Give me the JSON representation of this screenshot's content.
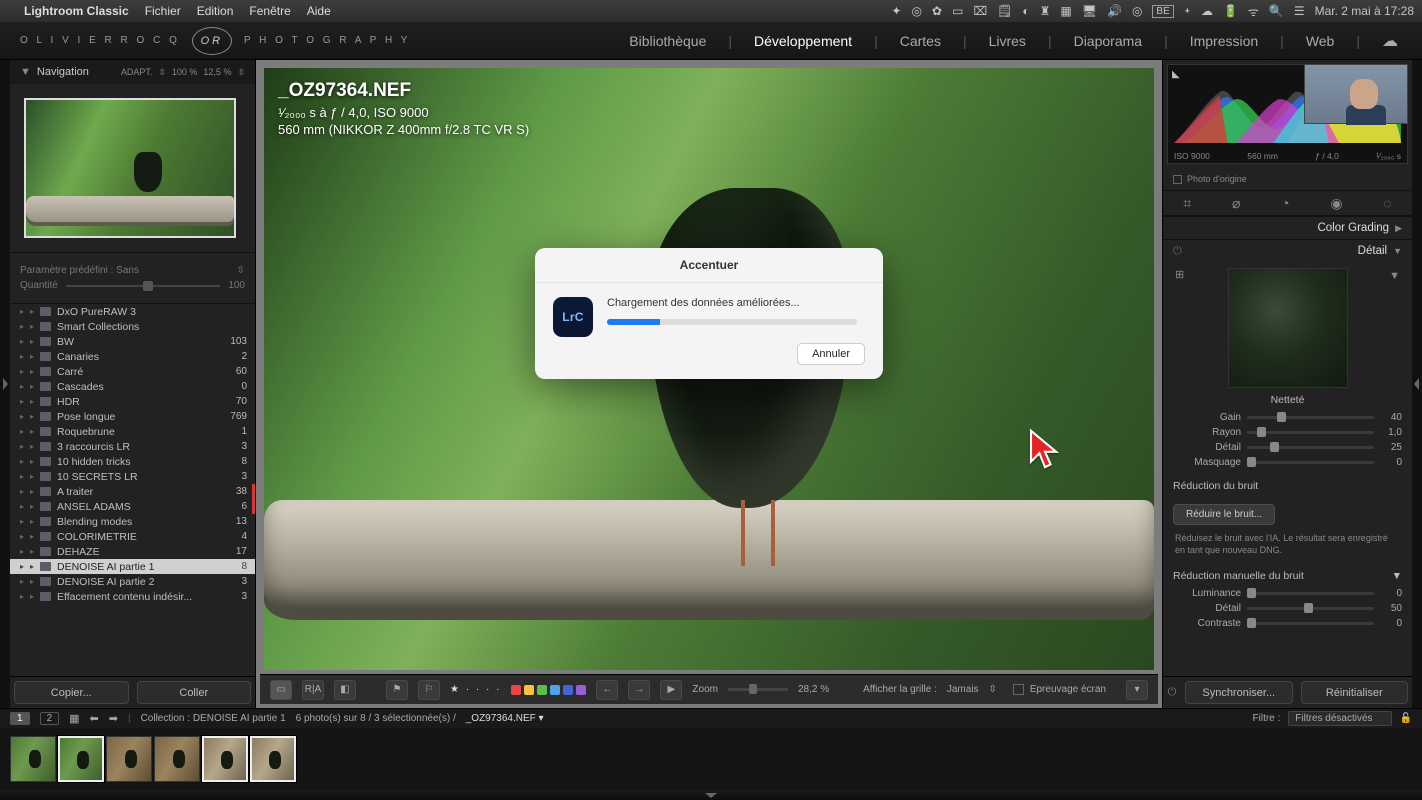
{
  "mac_menu": {
    "app": "Lightroom Classic",
    "items": [
      "Fichier",
      "Edition",
      "Fenêtre",
      "Aide"
    ],
    "datetime": "Mar. 2 mai à 17:28",
    "lang": "BE"
  },
  "brand": {
    "left": "O L I V I E R   R O C Q",
    "right": "P H O T O G R A P H Y",
    "monogram": "OR"
  },
  "modules": {
    "items": [
      "Bibliothèque",
      "Développement",
      "Cartes",
      "Livres",
      "Diaporama",
      "Impression",
      "Web"
    ],
    "active": "Développement"
  },
  "navigation": {
    "title": "Navigation",
    "fit_label": "ADAPT.",
    "zoom_a": "100 %",
    "zoom_b": "12,5 %"
  },
  "preset": {
    "label": "Paramètre prédéfini : Sans",
    "qty_label": "Quantité",
    "qty_value": "100"
  },
  "collections": [
    {
      "name": "DxO PureRAW 3",
      "count": ""
    },
    {
      "name": "Smart Collections",
      "count": ""
    },
    {
      "name": "BW",
      "count": "103"
    },
    {
      "name": "Canaries",
      "count": "2"
    },
    {
      "name": "Carré",
      "count": "60"
    },
    {
      "name": "Cascades",
      "count": "0"
    },
    {
      "name": "HDR",
      "count": "70"
    },
    {
      "name": "Pose longue",
      "count": "769"
    },
    {
      "name": "Roquebrune",
      "count": "1"
    },
    {
      "name": "3 raccourcis LR",
      "count": "3"
    },
    {
      "name": "10 hidden tricks",
      "count": "8"
    },
    {
      "name": "10 SECRETS LR",
      "count": "3"
    },
    {
      "name": "A traiter",
      "count": "38",
      "red": true
    },
    {
      "name": "ANSEL ADAMS",
      "count": "6",
      "red": true
    },
    {
      "name": "Blending modes",
      "count": "13"
    },
    {
      "name": "COLORIMETRIE",
      "count": "4"
    },
    {
      "name": "DEHAZE",
      "count": "17"
    },
    {
      "name": "DENOISE AI partie 1",
      "count": "8",
      "selected": true
    },
    {
      "name": "DENOISE AI partie 2",
      "count": "3"
    },
    {
      "name": "Effacement contenu indésir...",
      "count": "3"
    }
  ],
  "copy_paste": {
    "copy": "Copier...",
    "paste": "Coller"
  },
  "photo": {
    "filename": "_OZ97364.NEF",
    "exposure_line": "¹⁄₂₀₀₀ s à ƒ / 4,0, ISO 9000",
    "lens_line": "560 mm (NIKKOR Z 400mm f/2.8 TC VR S)"
  },
  "dialog": {
    "title": "Accentuer",
    "message": "Chargement des données améliorées...",
    "icon_text": "LrC",
    "cancel": "Annuler",
    "progress_pct": 21
  },
  "center_toolbar": {
    "zoom_label": "Zoom",
    "zoom_value": "28,2 %",
    "grid_label": "Afficher la grille :",
    "grid_value": "Jamais",
    "softproof": "Epreuvage écran",
    "palette": [
      "#e44",
      "#f5c242",
      "#5bbf4b",
      "#4aa4e6",
      "#3f64d6",
      "#9a5fd6"
    ]
  },
  "histogram": {
    "iso": "ISO 9000",
    "focal": "560 mm",
    "aperture": "ƒ / 4,0",
    "shutter": "¹⁄₂₀₀₀ s",
    "origin_label": "Photo d'origine"
  },
  "right_panels": {
    "color_grading": "Color Grading",
    "detail": "Détail",
    "sharpen": {
      "title": "Netteté",
      "gain": {
        "label": "Gain",
        "value": "40",
        "pos": 24
      },
      "rayon": {
        "label": "Rayon",
        "value": "1,0",
        "pos": 8
      },
      "detail": {
        "label": "Détail",
        "value": "25",
        "pos": 18
      },
      "mask": {
        "label": "Masquage",
        "value": "0",
        "pos": 0
      }
    },
    "noise_ai": {
      "title": "Réduction du bruit",
      "button": "Réduire le bruit...",
      "help": "Réduisez le bruit avec l'IA. Le résultat sera enregistré en tant que nouveau DNG."
    },
    "noise_manual": {
      "title": "Réduction manuelle du bruit",
      "lum": {
        "label": "Luminance",
        "value": "0",
        "pos": 0
      },
      "detail": {
        "label": "Détail",
        "value": "50",
        "pos": 45
      },
      "contrast": {
        "label": "Contraste",
        "value": "0",
        "pos": 0
      }
    }
  },
  "sync_row": {
    "sync": "Synchroniser...",
    "reset": "Réinitialiser"
  },
  "film_header": {
    "pages": [
      "1",
      "2"
    ],
    "collection_prefix": "Collection : ",
    "collection_name": "DENOISE AI partie 1",
    "count_text": "6 photo(s) sur 8 / 3 sélectionnée(s) /",
    "current": "_OZ97364.NEF",
    "filter_label": "Filtre :",
    "filter_value": "Filtres désactivés"
  }
}
